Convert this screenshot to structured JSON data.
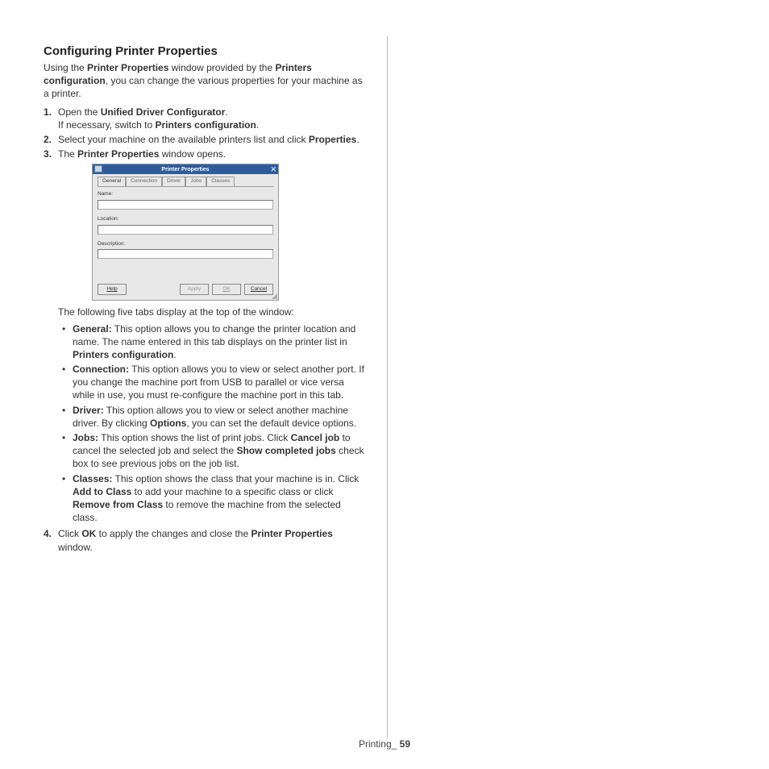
{
  "heading": "Configuring Printer Properties",
  "intro": {
    "prefix": "Using the ",
    "b1": "Printer Properties",
    "mid": " window provided by the ",
    "b2": "Printers configuration",
    "suffix": ", you can change the various properties for your machine as a printer."
  },
  "steps": {
    "s1": {
      "num": "1.",
      "prefix": "Open the ",
      "b": "Unified Driver Configurator",
      "suffix": ".",
      "line2a": "If necessary, switch to ",
      "line2b": "Printers configuration",
      "line2c": "."
    },
    "s2": {
      "num": "2.",
      "prefix": "Select your machine on the available printers list and click ",
      "b": "Properties",
      "suffix": "."
    },
    "s3": {
      "num": "3.",
      "prefix": "The ",
      "b": "Printer Properties",
      "suffix": " window opens."
    },
    "s4": {
      "num": "4.",
      "prefix": "Click ",
      "b": "OK",
      "mid": " to apply the changes and close the ",
      "b2": "Printer Properties",
      "suffix": " window."
    }
  },
  "dialog": {
    "title": "Printer Properties",
    "tabs": {
      "t0": "General",
      "t1": "Connection",
      "t2": "Driver",
      "t3": "Jobs",
      "t4": "Classes"
    },
    "labels": {
      "name": "Name:",
      "location": "Location:",
      "description": "Description:"
    },
    "buttons": {
      "help": "Help",
      "apply": "Apply",
      "ok": "OK",
      "cancel": "Cancel"
    }
  },
  "tabs_intro": "The following five tabs display at the top of the window:",
  "bullets": {
    "general": {
      "b": "General:",
      "text": "  This option allows you to change the printer location and name. The name entered in this tab displays on the printer list in ",
      "b2": "Printers configuration",
      "suffix": "."
    },
    "connection": {
      "b": "Connection:",
      "text": "  This option allows you to view or select another port. If you change the machine port from USB to parallel or vice versa while in use, you must re-configure the machine port in this tab."
    },
    "driver": {
      "b": "Driver:",
      "text": "  This option allows you to view or select another machine driver. By clicking ",
      "b2": "Options",
      "suffix": ", you can set the default device options."
    },
    "jobs": {
      "b": "Jobs:",
      "text": "  This option shows the list of print jobs. Click ",
      "b2": "Cancel job",
      "mid": " to cancel the selected job and select the ",
      "b3": "Show completed jobs",
      "suffix": " check box to see previous jobs on the job list."
    },
    "classes": {
      "b": "Classes:",
      "text": "  This option shows the class that your machine is in. Click ",
      "b2": "Add to Class",
      "mid": " to add your machine to a specific class or click ",
      "b3": "Remove from Class",
      "suffix": " to remove the machine from the selected class."
    }
  },
  "footer": {
    "label": "Printing_",
    "page": " 59"
  }
}
